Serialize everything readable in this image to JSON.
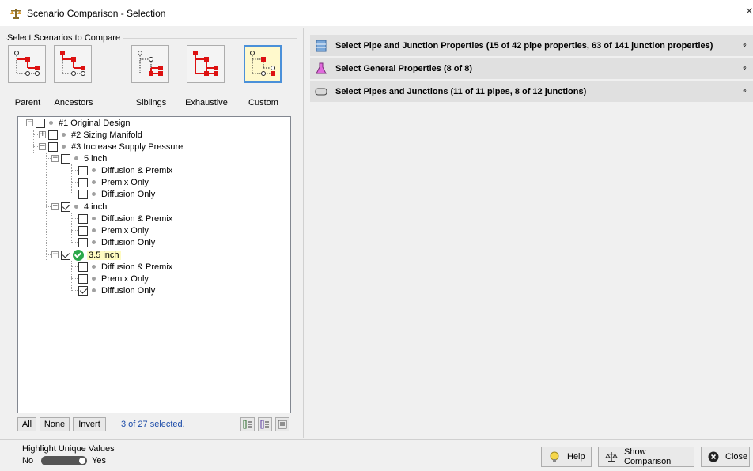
{
  "window": {
    "title": "Scenario Comparison - Selection",
    "close_glyph": "×"
  },
  "left": {
    "group_label": "Select Scenarios to Compare",
    "presets": [
      {
        "label": "Parent",
        "icon": "parent-tree-icon"
      },
      {
        "label": "Ancestors",
        "icon": "ancestors-tree-icon"
      },
      {
        "label": "Siblings",
        "icon": "siblings-tree-icon"
      },
      {
        "label": "Exhaustive",
        "icon": "exhaustive-tree-icon"
      },
      {
        "label": "Custom",
        "icon": "custom-tree-icon",
        "active": true
      }
    ],
    "tree": [
      {
        "label": "#1 Original Design",
        "level": 0,
        "expander": "−",
        "checked": false
      },
      {
        "label": "#2 Sizing Manifold",
        "level": 1,
        "expander": "+",
        "checked": false
      },
      {
        "label": "#3 Increase Supply Pressure",
        "level": 1,
        "expander": "−",
        "checked": false
      },
      {
        "label": "5 inch",
        "level": 2,
        "expander": "−",
        "checked": false
      },
      {
        "label": "Diffusion & Premix",
        "level": 3,
        "checked": false
      },
      {
        "label": "Premix Only",
        "level": 3,
        "checked": false
      },
      {
        "label": "Diffusion Only",
        "level": 3,
        "checked": false
      },
      {
        "label": "4 inch",
        "level": 2,
        "expander": "−",
        "checked": true
      },
      {
        "label": "Diffusion & Premix",
        "level": 3,
        "checked": false
      },
      {
        "label": "Premix Only",
        "level": 3,
        "checked": false
      },
      {
        "label": "Diffusion Only",
        "level": 3,
        "checked": false
      },
      {
        "label": "3.5 inch",
        "level": 2,
        "expander": "−",
        "checked": true,
        "current": true
      },
      {
        "label": "Diffusion & Premix",
        "level": 3,
        "checked": false
      },
      {
        "label": "Premix Only",
        "level": 3,
        "checked": false
      },
      {
        "label": "Diffusion Only",
        "level": 3,
        "checked": true
      }
    ],
    "buttons": {
      "all": "All",
      "none": "None",
      "invert": "Invert"
    },
    "selected_count": "3 of 27 selected."
  },
  "right": {
    "sections": [
      {
        "title": "Select Pipe and Junction Properties (15 of 42 pipe properties, 63 of 141 junction properties)",
        "icon": "table-properties-icon",
        "chevron": "»"
      },
      {
        "title": "Select General Properties (8 of 8)",
        "icon": "flask-icon",
        "chevron": "»"
      },
      {
        "title": "Select Pipes and Junctions (11 of 11 pipes, 8 of 12 junctions)",
        "icon": "pipe-icon",
        "chevron": "»"
      }
    ]
  },
  "footer": {
    "highlight_label": "Highlight Unique Values",
    "toggle_no": "No",
    "toggle_yes": "Yes",
    "toggle_on": true,
    "help_label": "Help",
    "show_comparison_label": "Show Comparison",
    "close_label": "Close"
  }
}
